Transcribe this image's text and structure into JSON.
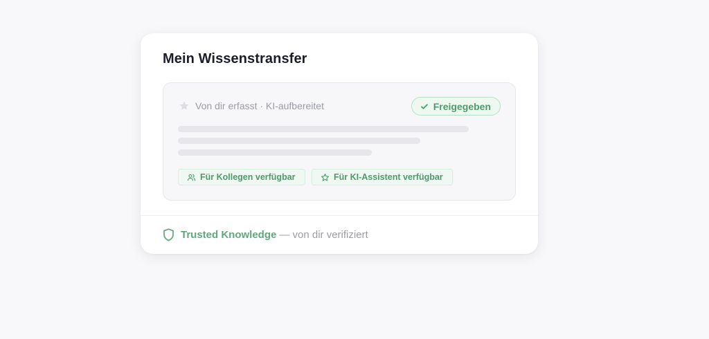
{
  "card": {
    "title": "Mein Wissenstransfer"
  },
  "entry": {
    "meta_text": "Von dir erfasst · KI-aufbereitet",
    "meta_icon": "star-icon",
    "status": {
      "label": "Freigegeben",
      "icon": "check-icon",
      "color": "#4f9a6c"
    },
    "tags": [
      {
        "label": "Für Kollegen verfügbar",
        "icon": "users-icon"
      },
      {
        "label": "Für KI-Assistent verfügbar",
        "icon": "star-icon"
      }
    ]
  },
  "footer": {
    "icon": "shield-icon",
    "highlight": "Trusted Knowledge",
    "rest": "— von dir verifiziert",
    "accent_color": "#5fa87a"
  }
}
